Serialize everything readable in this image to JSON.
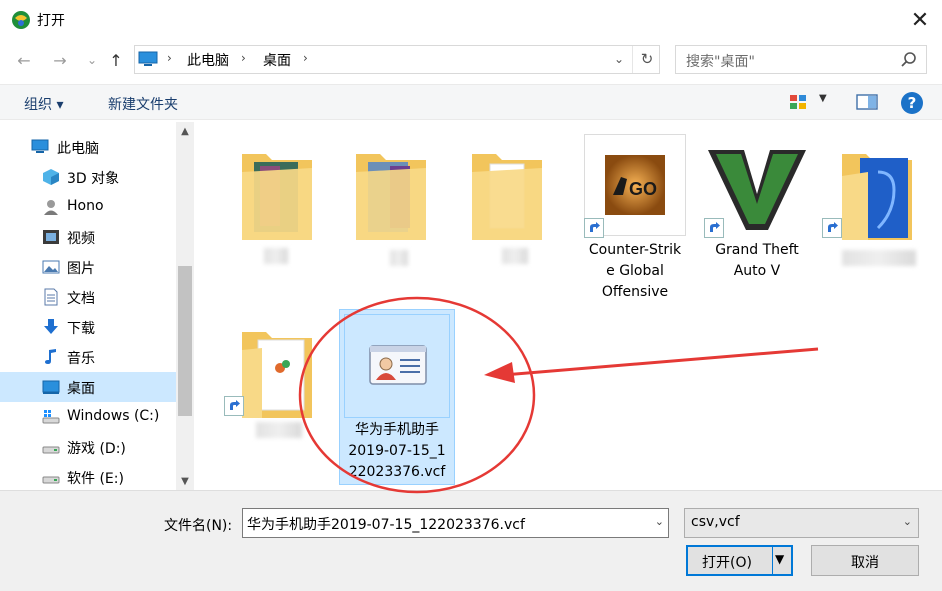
{
  "window": {
    "title": "打开",
    "close_glyph": "✕"
  },
  "nav": {
    "back_glyph": "←",
    "forward_glyph": "→",
    "recent_glyph": "⌄",
    "up_glyph": "↑",
    "breadcrumb": [
      "此电脑",
      "桌面"
    ],
    "breadcrumb_sep": "›",
    "dropdown_glyph": "⌄",
    "refresh_glyph": "↻",
    "search_placeholder": "搜索\"桌面\""
  },
  "toolbar": {
    "organize_label": "组织 ▾",
    "new_folder_label": "新建文件夹",
    "view_dd_glyph": "▼",
    "help_glyph": "?"
  },
  "sidebar": {
    "items": [
      {
        "label": "此电脑",
        "icon": "pc-icon",
        "root": true
      },
      {
        "label": "3D 对象",
        "icon": "3d-objects-icon"
      },
      {
        "label": "Hono",
        "icon": "user-icon"
      },
      {
        "label": "视频",
        "icon": "video-icon"
      },
      {
        "label": "图片",
        "icon": "pictures-icon"
      },
      {
        "label": "文档",
        "icon": "documents-icon"
      },
      {
        "label": "下载",
        "icon": "download-icon"
      },
      {
        "label": "音乐",
        "icon": "music-icon"
      },
      {
        "label": "桌面",
        "icon": "desktop-icon",
        "selected": true
      },
      {
        "label": "Windows (C:)",
        "icon": "windows-drive-icon"
      },
      {
        "label": "游戏 (D:)",
        "icon": "drive-icon"
      },
      {
        "label": "软件 (E:)",
        "icon": "drive-icon"
      }
    ],
    "scroll_up_glyph": "▲",
    "scroll_down_glyph": "▼"
  },
  "files": [
    {
      "label": "",
      "icon": "folder-icon"
    },
    {
      "label": "",
      "icon": "folder-icon"
    },
    {
      "label": "",
      "icon": "folder-icon"
    },
    {
      "label": "Counter-Strike Global Offensive",
      "label_lines": [
        "Counter-Strik",
        "e Global",
        "Offensive"
      ],
      "icon": "csgo-shortcut-icon",
      "badge_text": "GO"
    },
    {
      "label": "Grand Theft Auto V",
      "label_lines": [
        "Grand Theft",
        "Auto V"
      ],
      "icon": "gta5-shortcut-icon",
      "badge_text": "V"
    },
    {
      "label": "",
      "icon": "folder-shortcut-icon"
    },
    {
      "label": "",
      "icon": "folder-shortcut-icon"
    },
    {
      "label": "华为手机助手2019-07-15_122023376.vcf",
      "label_lines": [
        "华为手机助手",
        "2019-07-15_1",
        "22023376.vcf"
      ],
      "icon": "vcard-icon",
      "selected": true
    }
  ],
  "bottom": {
    "filename_label": "文件名(N):",
    "filename_value": "华为手机助手2019-07-15_122023376.vcf",
    "filetype_value": "csv,vcf",
    "open_label": "打开(O)",
    "cancel_label": "取消",
    "dd_glyph": "⌄",
    "open_dd_glyph": "▼"
  },
  "colors": {
    "accent": "#0078d7",
    "selection": "#cce8ff",
    "annotation": "#e53935",
    "folder": "#f6d26b"
  }
}
